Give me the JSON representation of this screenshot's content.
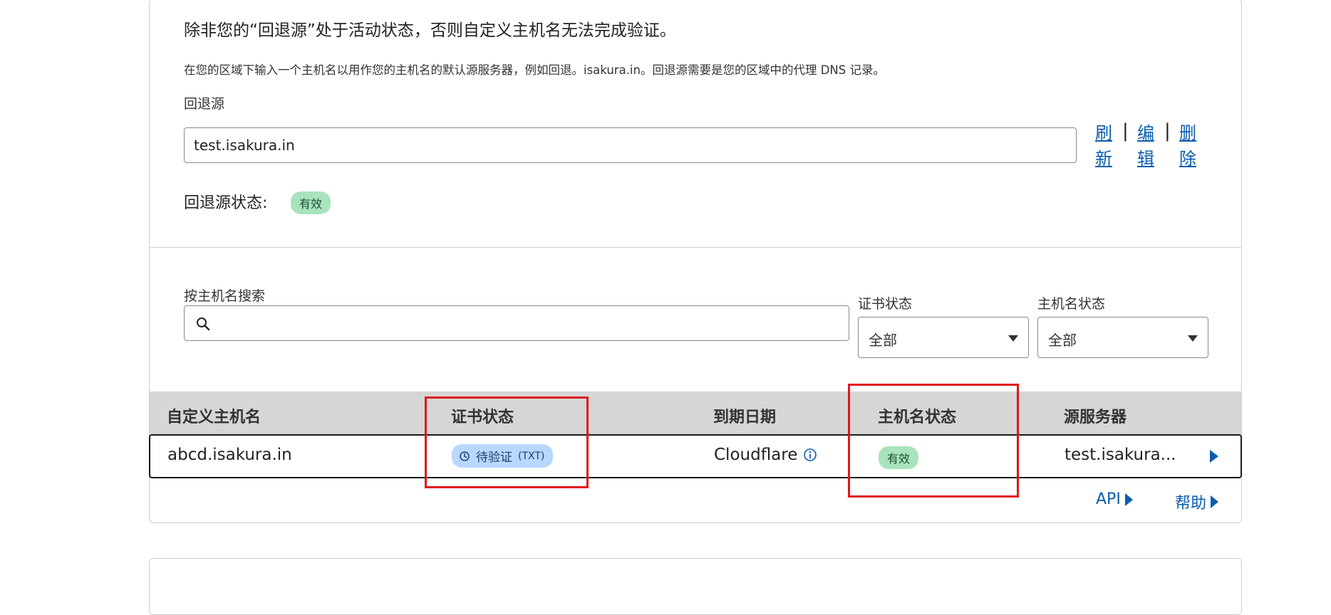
{
  "fallback": {
    "heading": "除非您的“回退源”处于活动状态，否则自定义主机名无法完成验证。",
    "description": "在您的区域下输入一个主机名以用作您的主机名的默认源服务器，例如回退。isakura.in。回退源需要是您的区域中的代理 DNS 记录。",
    "label": "回退源",
    "value": "test.isakura.in",
    "actions": [
      {
        "line1": "刷",
        "line2": "新"
      },
      {
        "line1": "编",
        "line2": "辑"
      },
      {
        "line1": "删",
        "line2": "除"
      }
    ],
    "status_label": "回退源状态:",
    "status_badge": "有效"
  },
  "search": {
    "label": "按主机名搜索",
    "placeholder": ""
  },
  "filters": {
    "cert_status": {
      "label": "证书状态",
      "value": "全部"
    },
    "hostname_status": {
      "label": "主机名状态",
      "value": "全部"
    }
  },
  "table": {
    "headers": [
      "自定义主机名",
      "证书状态",
      "到期日期",
      "主机名状态",
      "源服务器"
    ],
    "rows": [
      {
        "hostname": "abcd.isakura.in",
        "cert_status": "待验证",
        "cert_method": "(TXT)",
        "expiry": "Cloudflare",
        "hostname_status": "有效",
        "origin": "test.isakura..."
      }
    ]
  },
  "footer": {
    "api_label": "API",
    "help_label": "帮助"
  },
  "colors": {
    "link": "#0b5cad",
    "badge_green": "#a8e3bd",
    "badge_blue": "#b8d8ff",
    "highlight_red": "#e0161b"
  },
  "icons": [
    "search-icon",
    "clock-icon",
    "info-icon",
    "chevron-down-icon",
    "play-right-icon"
  ]
}
